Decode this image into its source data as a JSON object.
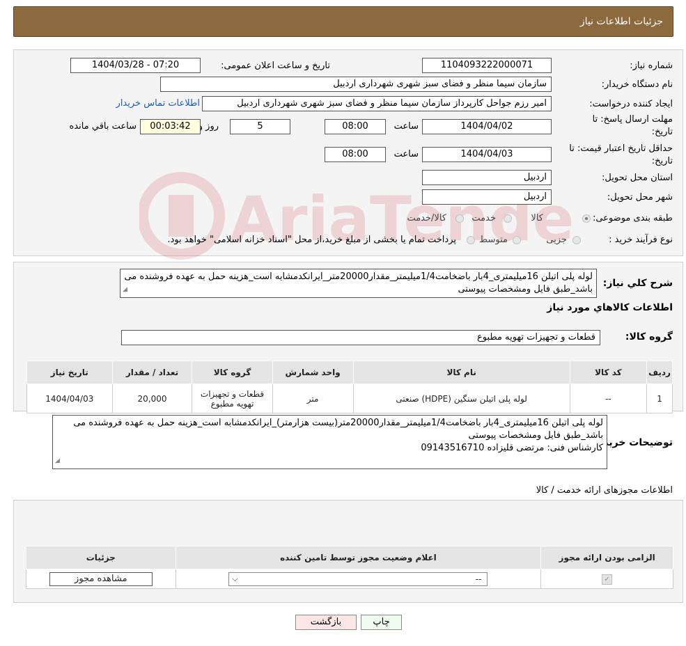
{
  "header": {
    "title": "جزئیات اطلاعات نیاز"
  },
  "form": {
    "need_number_label": "شماره نیاز:",
    "need_number": "1104093222000071",
    "announce_label": "تاریخ و ساعت اعلان عمومی:",
    "announce_value": "1404/03/28 - 07:20",
    "buyer_org_label": "نام دستگاه خریدار:",
    "buyer_org": "سازمان سیما منظر و فضای سبز شهری شهرداری اردبیل",
    "requester_label": "ایجاد کننده درخواست:",
    "requester": "امیر رزم جواحل کارپرداز سازمان سیما منظر و فضای سبز شهری شهرداری اردبیل",
    "contact_link": "اطلاعات تماس خریدار",
    "deadline_label_1": "مهلت ارسال پاسخ: تا",
    "deadline_label_2": "تاریخ:",
    "deadline_date": "1404/04/02",
    "time_label": "ساعت",
    "deadline_time": "08:00",
    "days_value": "5",
    "days_label": "روز و",
    "remaining_time": "00:03:42",
    "remaining_label": "ساعت باقي مانده",
    "validity_label_1": "حداقل تاریخ اعتبار قیمت: تا",
    "validity_label_2": "تاریخ:",
    "validity_date": "1404/04/03",
    "validity_time": "08:00",
    "province_label": "استان محل تحویل:",
    "province": "اردبیل",
    "city_label": "شهر محل تحویل:",
    "city": "اردبیل",
    "category_label": "طبقه بندی موضوعی:",
    "category_options": [
      "کالا",
      "خدمت",
      "کالا/خدمت"
    ],
    "category_selected": 0,
    "process_label": "نوع فرآیند خرید :",
    "process_options": [
      "جزیی",
      "متوسط"
    ],
    "process_note": "پرداخت تمام یا بخشی از مبلغ خرید،از محل \"اسناد خزانه اسلامی\" خواهد بود."
  },
  "desc": {
    "label": "شرح کلي نياز:",
    "text": "لوله پلی اتیلن 16میلیمتری_4بار باضخامت1/4میلیمتر_مقدار20000متر_ایرانکدمشابه است_هزینه حمل به عهده فروشنده می باشد_طبق فایل ومشخصات پیوستی"
  },
  "goods": {
    "section_title": "اطلاعات کالاهاي مورد نياز",
    "group_label": "گروه کالا:",
    "group_value": "قطعات و تجهیزات تهویه مطبوع",
    "columns": [
      "رديف",
      "کد کالا",
      "نام کالا",
      "واحد شمارش",
      "گروه کالا",
      "تعداد / مقدار",
      "تاریخ نیاز"
    ],
    "rows": [
      {
        "row": "1",
        "code": "--",
        "name": "لوله پلی اتیلن سنگین (HDPE) صنعتی",
        "unit": "متر",
        "group": "قطعات و تجهیزات تهویه مطبوع",
        "qty": "20,000",
        "date": "1404/04/03"
      }
    ]
  },
  "buyer_notes": {
    "label": "توضیحات خریدار:",
    "line1": "لوله پلی اتیلن 16میلیمتری_4بار باضخامت1/4میلیمتر_مقدار20000متر(بیست هزارمتر)_ایرانکدمشابه است_هزینه حمل به عهده فروشنده می باشد_طبق فایل ومشخصات پیوستی",
    "line2": "کارشناس فنی: مرتضی قلیزاده 09143516710"
  },
  "permits": {
    "section_title": "اطلاعات مجوزهای ارائه خدمت / کالا",
    "columns": [
      "الزامی بودن ارائه مجوز",
      "اعلام وضعیت مجوز توسط تامین کننده",
      "جزئیات"
    ],
    "select_value": "--",
    "view_button": "مشاهده مجوز"
  },
  "footer": {
    "print_button": "چاپ",
    "back_button": "بازگشت"
  },
  "watermark": {
    "text": "AriaTender.neT"
  }
}
